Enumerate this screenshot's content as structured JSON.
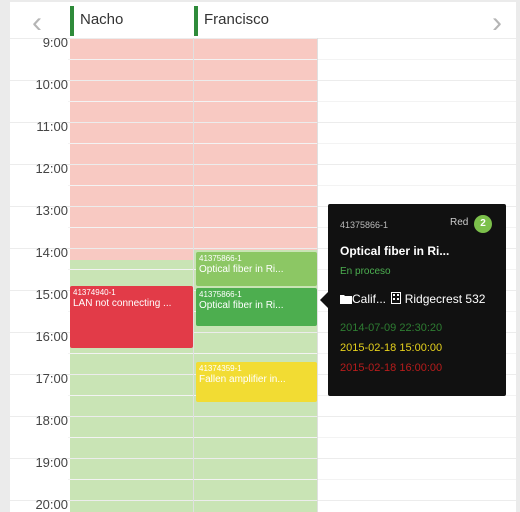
{
  "nav": {
    "prev": "‹",
    "next": "›"
  },
  "columns": [
    {
      "name": "Nacho"
    },
    {
      "name": "Francisco"
    }
  ],
  "times": [
    "9:00",
    "10:00",
    "11:00",
    "12:00",
    "13:00",
    "14:00",
    "15:00",
    "16:00",
    "17:00",
    "18:00",
    "19:00",
    "20:00"
  ],
  "colors": {
    "unavailable": "#f8c9c2",
    "available": "#c9e4b5",
    "event_red": "#e23b48",
    "event_green": "#4dae4f",
    "event_lightgreen": "#8cc764",
    "event_yellow": "#f2dc33",
    "column_marker": "#2e8b3a"
  },
  "events": {
    "nacho_lan": {
      "id": "41374940-1",
      "title": "LAN not connecting ..."
    },
    "fran_fiber_a": {
      "id": "41375866-1",
      "title": "Optical fiber in Ri..."
    },
    "fran_fiber_b": {
      "id": "41375866-1",
      "title": "Optical fiber in Ri..."
    },
    "fran_amp": {
      "id": "41374359-1",
      "title": "Fallen amplifier in..."
    }
  },
  "popup": {
    "id": "41375866-1",
    "group": "Red",
    "badge": "2",
    "title": "Optical fiber in Ri...",
    "status": "En proceso",
    "location_state": "Calif...",
    "location_city": "Ridgecrest 532",
    "date_created": "2014-07-09 22:30:20",
    "date_start": "2015-02-18 15:00:00",
    "date_end": "2015-02-18 16:00:00"
  }
}
